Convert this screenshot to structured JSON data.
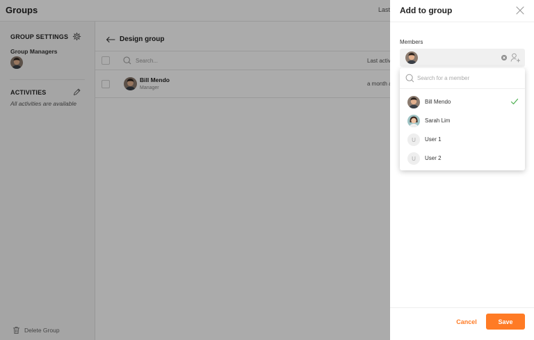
{
  "app": {
    "title": "Groups",
    "topbar_last": "Last"
  },
  "sidebar": {
    "group_settings_heading": "GROUP SETTINGS",
    "group_managers_label": "Group Managers",
    "activities_heading": "ACTIVITIES",
    "activities_note": "All activities are available",
    "delete_group_label": "Delete Group"
  },
  "main": {
    "breadcrumb": "Design group",
    "search_placeholder": "Search...",
    "last_activity_header": "Last activi",
    "rows": [
      {
        "name": "Bill Mendo",
        "role": "Manager",
        "last_activity": "a month a"
      }
    ]
  },
  "panel": {
    "title": "Add to group",
    "members_label": "Members",
    "search_placeholder": "Search for a member",
    "members": [
      {
        "name": "Bill Mendo",
        "avatar": "photo",
        "selected": true
      },
      {
        "name": "Sarah Lim",
        "avatar": "photo",
        "selected": false
      },
      {
        "name": "User 1",
        "avatar": "U",
        "selected": false
      },
      {
        "name": "User 2",
        "avatar": "U",
        "selected": false
      }
    ],
    "cancel_label": "Cancel",
    "save_label": "Save"
  },
  "colors": {
    "accent": "#ff7b25",
    "check": "#4caf50",
    "overlay": "rgba(0,0,0,0.33)"
  },
  "icons": [
    "gear-icon",
    "pencil-icon",
    "trash-icon",
    "arrow-left-icon",
    "search-icon",
    "close-icon",
    "clear-icon",
    "add-user-icon",
    "check-icon"
  ]
}
